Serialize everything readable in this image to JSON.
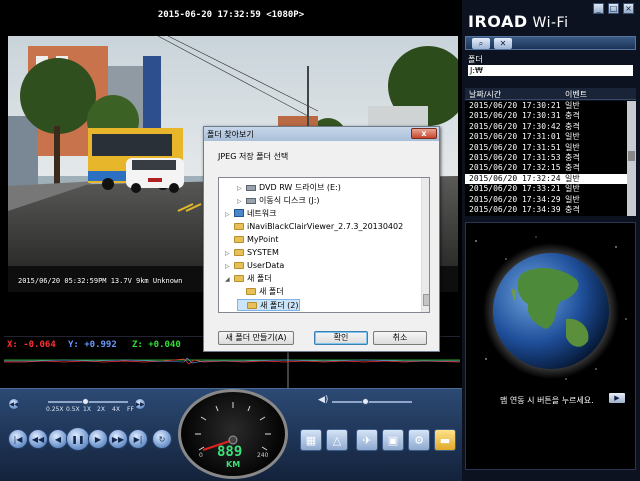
{
  "video": {
    "title": "2015-06-20 17:32:59 <1080P>",
    "overlay": "2015/06/20 05:32:59PM 13.7V  9km Unknown"
  },
  "gsensor": {
    "x_label": "X: -0.064",
    "y_label": "Y: +0.992",
    "z_label": "Z: +0.040",
    "colors": {
      "x": "#ff3030",
      "y": "#6699ff",
      "z": "#33dd33"
    }
  },
  "controls": {
    "speed_labels": [
      "0.25X",
      "0.5X",
      "1X",
      "2X",
      "4X",
      "FF"
    ],
    "speedo_value": "889",
    "speedo_unit": "KM",
    "speedo_scale": [
      "0",
      "240"
    ],
    "playback_buttons": [
      "first-icon",
      "rewind-icon",
      "step-back-icon",
      "pause-icon",
      "play-icon",
      "fast-forward-icon",
      "last-icon",
      "repeat-icon"
    ],
    "tool_buttons": [
      "film-icon",
      "snapshot-icon",
      "satellite-icon",
      "save-icon",
      "settings-icon",
      "folder-icon"
    ]
  },
  "right_panel": {
    "logo_main": "IROAD",
    "logo_wifi": " Wi-Fi",
    "folder_label": "폴더",
    "folder_value": "J:₩",
    "col_datetime": "날짜/시간",
    "col_event": "이벤트",
    "files": [
      {
        "datetime": "2015/06/20 17:30:21",
        "event": "일반"
      },
      {
        "datetime": "2015/06/20 17:30:31",
        "event": "충격"
      },
      {
        "datetime": "2015/06/20 17:30:42",
        "event": "충격"
      },
      {
        "datetime": "2015/06/20 17:31:01",
        "event": "일반"
      },
      {
        "datetime": "2015/06/20 17:31:51",
        "event": "일반"
      },
      {
        "datetime": "2015/06/20 17:31:53",
        "event": "충격"
      },
      {
        "datetime": "2015/06/20 17:32:15",
        "event": "충격"
      },
      {
        "datetime": "2015/06/20 17:32:24",
        "event": "일반"
      },
      {
        "datetime": "2015/06/20 17:33:21",
        "event": "일반"
      },
      {
        "datetime": "2015/06/20 17:34:29",
        "event": "일반"
      },
      {
        "datetime": "2015/06/20 17:34:39",
        "event": "충격"
      }
    ],
    "selected_index": 7,
    "map_caption": "맵 연동 시 버튼을 누르세요.",
    "map_button": "▶"
  },
  "dialog": {
    "title": "폴더 찾아보기",
    "close": "x",
    "prompt": "JPEG 저장 폴더 선택",
    "tree": [
      {
        "label": "DVD RW 드라이브 (E:)",
        "icon": "drive",
        "arrow": "▷",
        "indent": 1
      },
      {
        "label": "이동식 디스크 (J:)",
        "icon": "drive",
        "arrow": "▷",
        "indent": 1
      },
      {
        "label": "네트워크",
        "icon": "network",
        "arrow": "▷",
        "indent": 0
      },
      {
        "label": "iNaviBlackClairViewer_2.7.3_20130402",
        "icon": "folder",
        "arrow": "",
        "indent": 0
      },
      {
        "label": "MyPoint",
        "icon": "folder",
        "arrow": "",
        "indent": 0
      },
      {
        "label": "SYSTEM",
        "icon": "folder",
        "arrow": "▷",
        "indent": 0
      },
      {
        "label": "UserData",
        "icon": "folder",
        "arrow": "▷",
        "indent": 0
      },
      {
        "label": "새 폴더",
        "icon": "folder",
        "arrow": "◢",
        "indent": 0
      },
      {
        "label": "새 폴더",
        "icon": "folder",
        "arrow": "",
        "indent": 1
      },
      {
        "label": "새 폴더 (2)",
        "icon": "folder",
        "arrow": "",
        "indent": 1
      }
    ],
    "selected_tree_index": 9,
    "btn_new_folder": "새 폴더 만들기(A)",
    "btn_ok": "확인",
    "btn_cancel": "취소"
  }
}
